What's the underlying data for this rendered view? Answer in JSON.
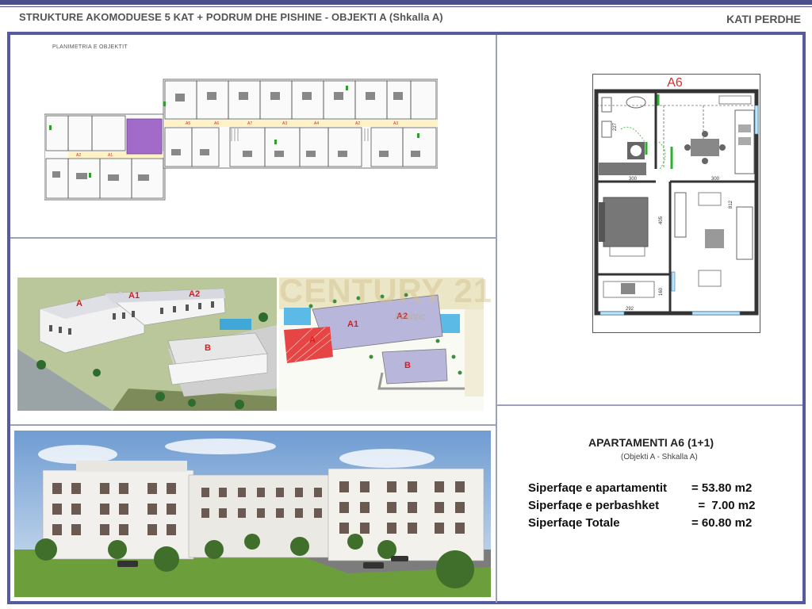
{
  "header": {
    "title": "STRUKTURE AKOMODUESE 5 KAT + PODRUM DHE PISHINE   -  OBJEKTI A (Shkalla A)",
    "right_label": "KATI PERDHE"
  },
  "site_plan": {
    "label": "PLANIMETRIA E OBJEKTIT"
  },
  "render_labels": {
    "a": "A",
    "a1": "A1",
    "a2": "A2",
    "b": "B"
  },
  "map_labels": {
    "a": "A",
    "a1": "A1",
    "a2": "A2",
    "b": "B"
  },
  "watermark": {
    "brand": "CENTURY 21",
    "sub": "Atlantic"
  },
  "floorplan": {
    "title": "A6",
    "dims": {
      "d1": "300",
      "d2": "300",
      "d3": "292",
      "d4": "405",
      "d5": "812",
      "d6": "160",
      "d7": "227"
    }
  },
  "apartment": {
    "title": "APARTAMENTI A6 (1+1)",
    "subtitle": "(Objekti A - Shkalla A)",
    "areas": [
      {
        "label": "Siperfaqe e apartamentit",
        "value": "= 53.80 m2"
      },
      {
        "label": "Siperfaqe e perbashket",
        "value": "  =  7.00 m2"
      },
      {
        "label": "Siperfaqe Totale",
        "value": "= 60.80 m2"
      }
    ]
  },
  "colors": {
    "frame": "#555b9e",
    "accent": "#e01a1a",
    "roof": "#b9b6dc"
  }
}
